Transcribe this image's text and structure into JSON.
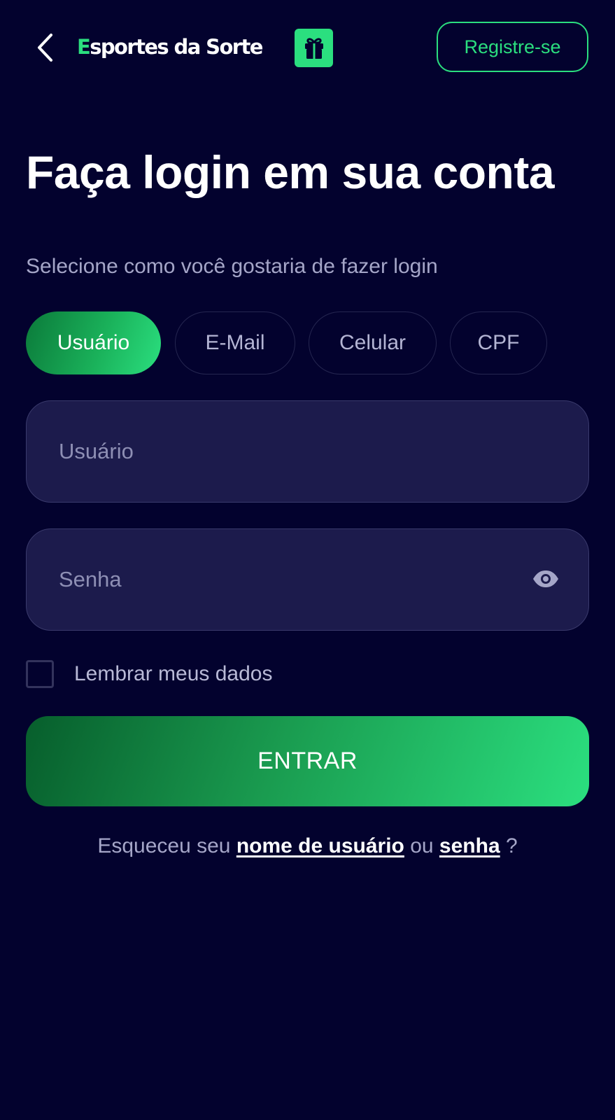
{
  "header": {
    "back_icon": "chevron-left-icon",
    "logo": {
      "first_letter": "E",
      "rest": "sportes da Sorte"
    },
    "gift_icon": "gift-icon",
    "register_label": "Registre-se"
  },
  "main": {
    "title": "Faça login em sua conta",
    "subtitle": "Selecione como você gostaria de fazer login",
    "tabs": [
      {
        "label": "Usuário",
        "active": true
      },
      {
        "label": "E-Mail",
        "active": false
      },
      {
        "label": "Celular",
        "active": false
      },
      {
        "label": "CPF",
        "active": false
      }
    ],
    "username_field": {
      "placeholder": "Usuário",
      "value": ""
    },
    "password_field": {
      "placeholder": "Senha",
      "value": "",
      "toggle_icon": "eye-icon"
    },
    "remember": {
      "label": "Lembrar meus dados",
      "checked": false
    },
    "submit_label": "ENTRAR",
    "forgot": {
      "prefix": "Esqueceu seu",
      "username_link": "nome de usuário",
      "middle": "ou",
      "password_link": "senha",
      "suffix": "?"
    }
  },
  "colors": {
    "background": "#03022e",
    "accent": "#2bdf7f",
    "field_background": "#1c1b4c"
  }
}
